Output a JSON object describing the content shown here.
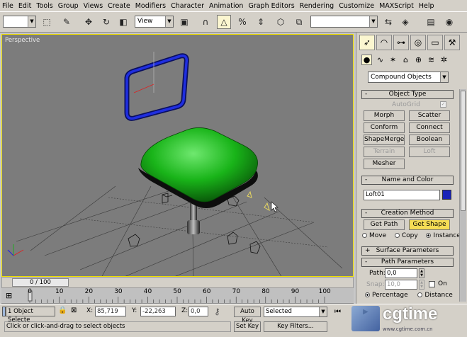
{
  "menu": [
    "File",
    "Edit",
    "Tools",
    "Group",
    "Views",
    "Create",
    "Modifiers",
    "Character",
    "Animation",
    "Graph Editors",
    "Rendering",
    "Customize",
    "MAXScript",
    "Help"
  ],
  "toolbar": {
    "selection_set_value": "",
    "coord_system": "View",
    "named_selection": ""
  },
  "viewport": {
    "label": "Perspective"
  },
  "time": {
    "slider_label": "0 / 100",
    "ticks": [
      "0",
      "10",
      "20",
      "30",
      "40",
      "50",
      "60",
      "70",
      "80",
      "90",
      "100"
    ]
  },
  "status": {
    "selection_info": "1 Object Selecte",
    "x_label": "X:",
    "x_value": "85,719",
    "y_label": "Y:",
    "y_value": "-22,263",
    "z_label": "Z:",
    "z_value": "0,0",
    "auto_key_label": "Auto Key",
    "key_mode": "Selected",
    "set_key_label": "Set Key",
    "key_filters_label": "Key Filters...",
    "prompt": "Click or click-and-drag to select objects",
    "watermark_logo": "cgtime",
    "watermark_url": "www.cgtime.com.cn"
  },
  "panel": {
    "category": "Compound Objects",
    "object_type": {
      "title": "Object Type",
      "autogrid_label": "AutoGrid",
      "buttons": [
        "Morph",
        "Scatter",
        "Conform",
        "Connect",
        "ShapeMerge",
        "Boolean",
        "Terrain",
        "Loft",
        "Mesher"
      ]
    },
    "name_color": {
      "title": "Name and Color",
      "name_value": "Loft01",
      "color": "#1a23b8"
    },
    "creation_method": {
      "title": "Creation Method",
      "get_path_label": "Get Path",
      "get_shape_label": "Get Shape",
      "move_label": "Move",
      "copy_label": "Copy",
      "instance_label": "Instance"
    },
    "surface_params_title": "Surface Parameters",
    "path_params": {
      "title": "Path Parameters",
      "path_label": "Path:",
      "path_value": "0,0",
      "snap_label": "Snap:",
      "snap_value": "10,0",
      "on_label": "On",
      "percentage_label": "Percentage",
      "distance_label": "Distance"
    }
  },
  "colors": {
    "ui_gray": "#d4d0c8",
    "viewport_bg": "#7c7c7c",
    "active_yellow": "#f5dd55",
    "seat_green": "#19b419",
    "path_blue": "#1a23b8"
  }
}
